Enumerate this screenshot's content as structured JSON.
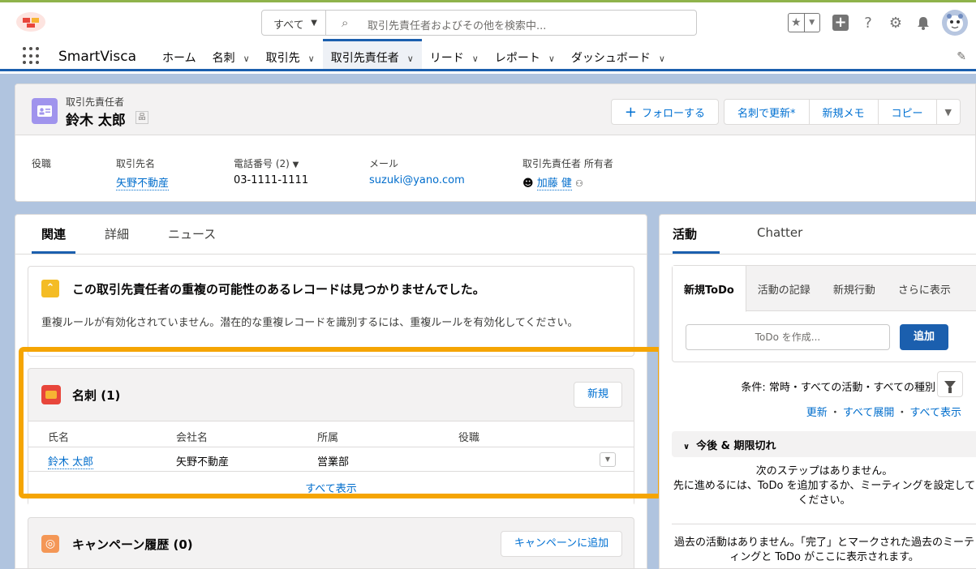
{
  "header": {
    "search_scope": "すべて",
    "search_placeholder": "取引先責任者およびその他を検索中..."
  },
  "nav": {
    "app_name": "SmartVisca",
    "items": [
      {
        "label": "ホーム",
        "has_menu": false
      },
      {
        "label": "名刺",
        "has_menu": true
      },
      {
        "label": "取引先",
        "has_menu": true
      },
      {
        "label": "取引先責任者",
        "has_menu": true,
        "active": true
      },
      {
        "label": "リード",
        "has_menu": true
      },
      {
        "label": "レポート",
        "has_menu": true
      },
      {
        "label": "ダッシュボード",
        "has_menu": true
      }
    ]
  },
  "record": {
    "type": "取引先責任者",
    "name": "鈴木 太郎",
    "buttons": {
      "follow": "フォローする",
      "update_by_card": "名刺で更新*",
      "new_memo": "新規メモ",
      "copy": "コピー"
    },
    "fields": [
      {
        "label": "役職",
        "value": ""
      },
      {
        "label": "取引先名",
        "value": "矢野不動産"
      },
      {
        "label": "電話番号 (2)",
        "value": "03-1111-1111"
      },
      {
        "label": "メール",
        "value": "suzuki@yano.com"
      },
      {
        "label": "取引先責任者 所有者",
        "value": "加藤 健"
      }
    ]
  },
  "left_tabs": [
    "関連",
    "詳細",
    "ニュース"
  ],
  "duplicate": {
    "title": "この取引先責任者の重複の可能性のあるレコードは見つかりませんでした。",
    "description": "重複ルールが有効化されていません。潜在的な重複レコードを識別するには、重複ルールを有効化してください。"
  },
  "meishi": {
    "title": "名刺 (1)",
    "new_label": "新規",
    "columns": [
      "氏名",
      "会社名",
      "所属",
      "役職"
    ],
    "rows": [
      [
        "鈴木 太郎",
        "矢野不動産",
        "営業部",
        ""
      ]
    ],
    "view_all": "すべて表示"
  },
  "campaign": {
    "title": "キャンペーン履歴 (0)",
    "add_label": "キャンペーンに追加"
  },
  "activity": {
    "tabs": [
      "活動",
      "Chatter"
    ],
    "publisher_tabs": [
      "新規ToDo",
      "活動の記録",
      "新規行動",
      "さらに表示"
    ],
    "todo_placeholder": "ToDo を作成...",
    "add_label": "追加",
    "filter_text": "条件: 常時・すべての活動・すべての種別",
    "links": [
      "更新",
      "すべて展開",
      "すべて表示"
    ],
    "upcoming_label": "今後 & 期限切れ",
    "no_steps_1": "次のステップはありません。",
    "no_steps_2": "先に進めるには、ToDo を追加するか、ミーティングを設定してください。",
    "no_past": "過去の活動はありません。「完了」とマークされた過去のミーティングと ToDo がここに表示されます。"
  },
  "colors": {
    "brand_blue": "#1b5fae",
    "link_blue": "#006dcc",
    "highlight_orange": "#f5a503",
    "contact_icon": "#a094ed"
  }
}
